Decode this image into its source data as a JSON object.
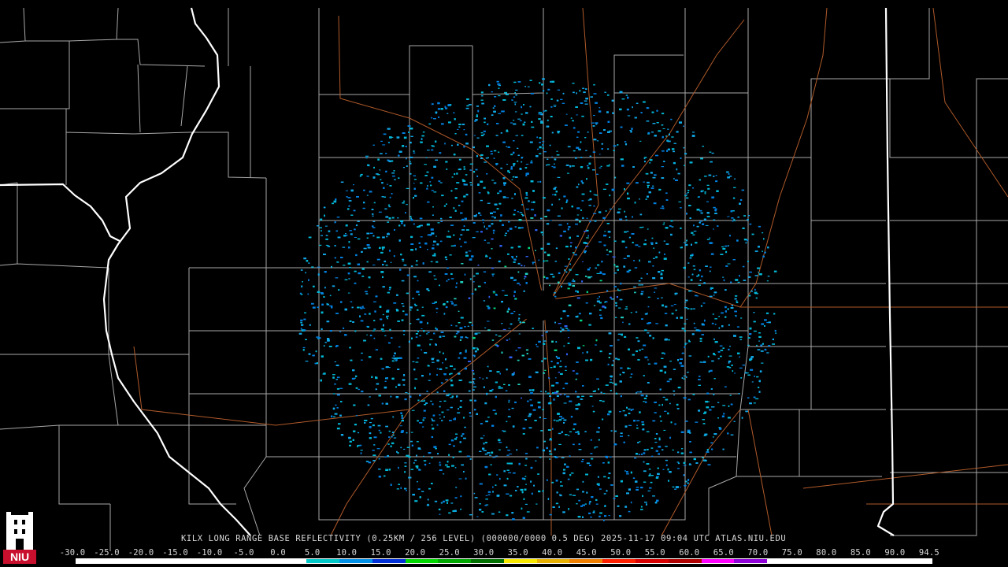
{
  "product_line": "KILX LONG RANGE BASE REFLECTIVITY (0.25KM / 256 LEVEL) (000000/0000 0.5 DEG) 2025-11-17 09:04 UTC  ATLAS.NIU.EDU",
  "scale": {
    "labels": [
      "-30.0",
      "-25.0",
      "-20.0",
      "-15.0",
      "-10.0",
      "-5.0",
      "0.0",
      "5.0",
      "10.0",
      "15.0",
      "20.0",
      "25.0",
      "30.0",
      "35.0",
      "40.0",
      "45.0",
      "50.0",
      "55.0",
      "60.0",
      "65.0",
      "70.0",
      "75.0",
      "80.0",
      "85.0",
      "90.0",
      "94.5"
    ],
    "colors": [
      "#ffffff",
      "#ffffff",
      "#ffffff",
      "#ffffff",
      "#ffffff",
      "#ffffff",
      "#ffffff",
      "#00c8c8",
      "#0090e8",
      "#0030d8",
      "#00d800",
      "#00a800",
      "#007000",
      "#f8e800",
      "#e8b000",
      "#f08000",
      "#ff2000",
      "#d80000",
      "#b00000",
      "#ff00ff",
      "#9000d8",
      "#ffffff",
      "#ffffff",
      "#ffffff",
      "#ffffff",
      "#ffffff"
    ]
  },
  "logo": {
    "text": "NIU",
    "icon": "niu-castle-logo-icon"
  },
  "map": {
    "radar_site": "KILX",
    "echo_colors": [
      "#00b8d8",
      "#10a8e8",
      "#0080e0",
      "#20d0c0",
      "#3060f0",
      "#00d880"
    ],
    "state_border_color": "#ffffff",
    "county_border_color": "#a8a8a8",
    "highway_color": "#b05a2a"
  }
}
